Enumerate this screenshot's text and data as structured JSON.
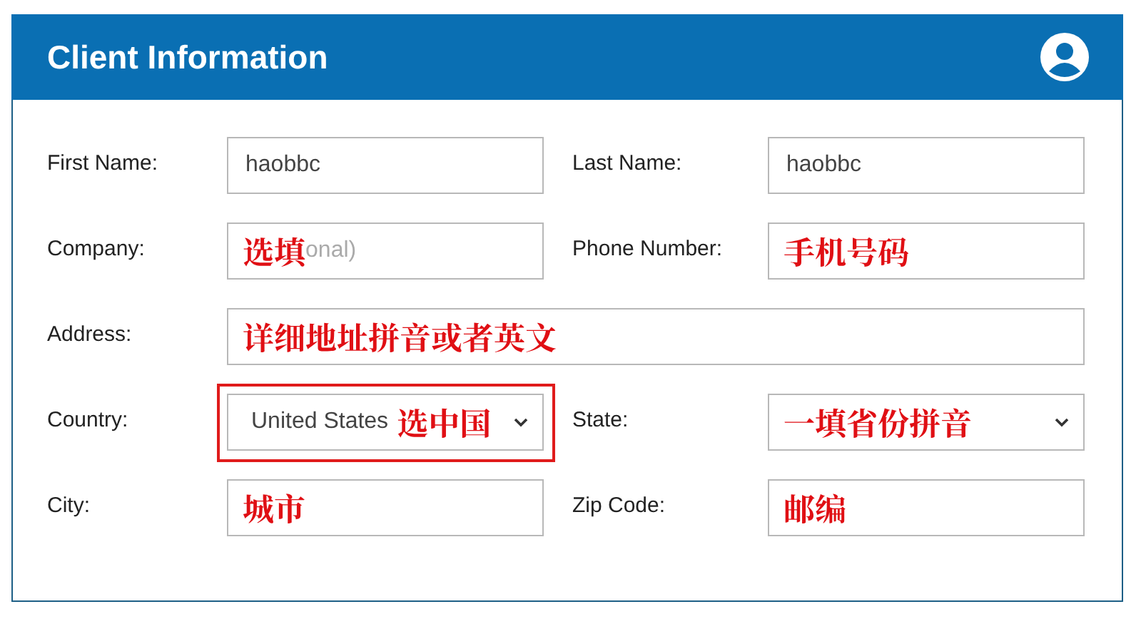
{
  "header": {
    "title": "Client Information"
  },
  "fields": [
    {
      "label": "First Name:",
      "kind": "text",
      "value": "haobbc"
    },
    {
      "label": "Last Name:",
      "kind": "text",
      "value": "haobbc"
    },
    {
      "label": "Company:",
      "kind": "text",
      "annotation": "选填",
      "placeholder": "onal)"
    },
    {
      "label": "Phone Number:",
      "kind": "text",
      "annotation": "手机号码"
    },
    {
      "label": "Address:",
      "kind": "text",
      "wide": true,
      "annotation": "详细地址拼音或者英文"
    },
    {
      "label": "Country:",
      "kind": "select",
      "value": "United States",
      "annotation": "选中国",
      "highlighted": true
    },
    {
      "label": "State:",
      "kind": "select",
      "annotation": "一填省份拼音"
    },
    {
      "label": "City:",
      "kind": "text",
      "annotation": "城市"
    },
    {
      "label": "Zip Code:",
      "kind": "text",
      "annotation": "邮编"
    }
  ]
}
